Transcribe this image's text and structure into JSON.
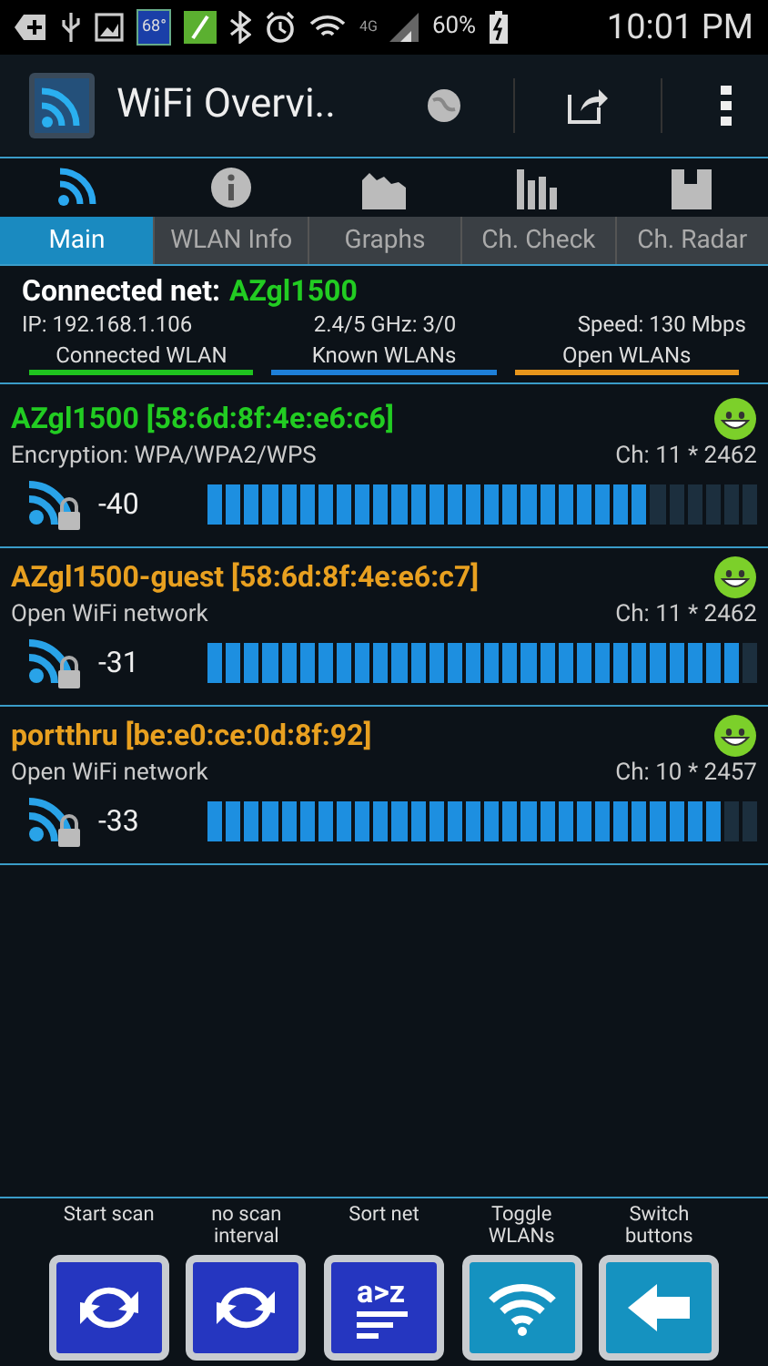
{
  "status_bar": {
    "weather": "68°",
    "network": "4G",
    "battery": "60%",
    "time": "10:01 PM"
  },
  "action_bar": {
    "title": "WiFi Overvi.."
  },
  "tabs": [
    {
      "label": "Main",
      "kind": "wifi",
      "selected": true
    },
    {
      "label": "WLAN Info",
      "kind": "info",
      "selected": false
    },
    {
      "label": "Graphs",
      "kind": "graph",
      "selected": false
    },
    {
      "label": "Ch. Check",
      "kind": "bars",
      "selected": false
    },
    {
      "label": "Ch. Radar",
      "kind": "radar",
      "selected": false
    }
  ],
  "connected": {
    "label": "Connected net:",
    "name": "AZgl1500",
    "ip": "IP: 192.168.1.106",
    "bands": "2.4/5 GHz: 3/0",
    "speed": "Speed: 130 Mbps"
  },
  "legend": [
    {
      "label": "Connected WLAN",
      "color": "#1fc41f"
    },
    {
      "label": "Known WLANs",
      "color": "#1e7fd8"
    },
    {
      "label": "Open WLANs",
      "color": "#e8961c"
    }
  ],
  "networks": [
    {
      "name": "AZgl1500 [58:6d:8f:4e:e6:c6]",
      "color": "#22cc22",
      "security": "Encryption: WPA/WPA2/WPS",
      "channel": "Ch: 11 * 2462",
      "signal": "-40",
      "level": 0.8
    },
    {
      "name": "AZgl1500-guest [58:6d:8f:4e:e6:c7]",
      "color": "#e8a020",
      "security": "Open WiFi network",
      "channel": "Ch: 11 * 2462",
      "signal": "-31",
      "level": 0.95
    },
    {
      "name": "portthru [be:e0:ce:0d:8f:92]",
      "color": "#e8a020",
      "security": "Open WiFi network",
      "channel": "Ch: 10 * 2457",
      "signal": "-33",
      "level": 0.92
    }
  ],
  "toolbar": [
    {
      "label": "Start scan",
      "kind": "refresh"
    },
    {
      "label": "no scan interval",
      "kind": "refresh"
    },
    {
      "label": "Sort net",
      "kind": "sort",
      "glyph": "a>z"
    },
    {
      "label": "Toggle WLANs",
      "kind": "wifi"
    },
    {
      "label": "Switch buttons",
      "kind": "arrow"
    }
  ]
}
